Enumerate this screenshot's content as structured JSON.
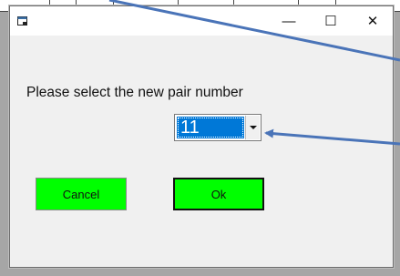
{
  "window": {
    "minimize_glyph": "—",
    "maximize_glyph": "☐",
    "close_glyph": "✕",
    "icon": "app-window-icon"
  },
  "dialog": {
    "prompt": "Please select the new pair number",
    "select": {
      "value": "11",
      "icon": "dropdown-arrow-icon"
    },
    "cancel_label": "Cancel",
    "ok_label": "Ok"
  },
  "colors": {
    "button_bg": "#00ff00",
    "selection_bg": "#0078d7",
    "annotation_arrow": "#4a74b8"
  }
}
